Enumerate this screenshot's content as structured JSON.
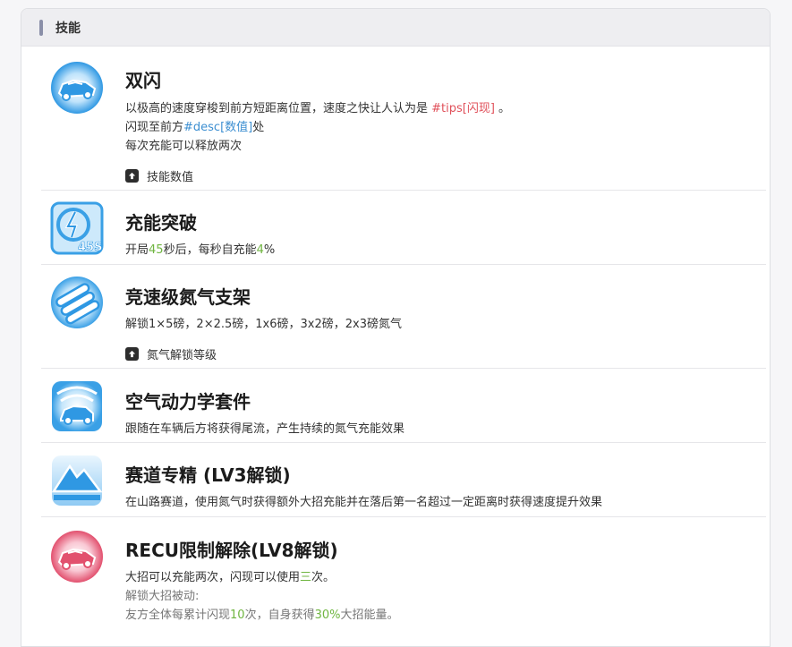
{
  "header": {
    "title": "技能"
  },
  "skills": [
    {
      "name": "双闪",
      "icon": "car-dash-icon",
      "l1a": "以极高的速度穿梭到前方短距离位置，速度之快让人认为是 ",
      "l1b": "#tips[闪现]",
      "l1c": " 。",
      "l2a": "闪现至前方",
      "l2b": "#desc[数值]",
      "l2c": "处",
      "l3": "每次充能可以释放两次",
      "toggle": "技能数值"
    },
    {
      "name": "充能突破",
      "icon": "timer-45s-icon",
      "l1a": "开局",
      "l1b": "45",
      "l1c": "秒后，每秒自充能",
      "l1d": "4",
      "l1e": "%"
    },
    {
      "name": "竞速级氮气支架",
      "icon": "nitro-tanks-icon",
      "l1": "解锁1×5磅，2×2.5磅，1x6磅，3x2磅，2x3磅氮气",
      "toggle": "氮气解锁等级"
    },
    {
      "name": "空气动力学套件",
      "icon": "aero-car-icon",
      "l1": "跟随在车辆后方将获得尾流，产生持续的氮气充能效果"
    },
    {
      "name": "赛道专精 (LV3解锁)",
      "icon": "mountain-icon",
      "l1": "在山路赛道，使用氮气时获得额外大招充能并在落后第一名超过一定距离时获得速度提升效果"
    },
    {
      "name": "RECU限制解除(LV8解锁)",
      "icon": "car-dash-red-icon",
      "l1a": "大招可以充能两次，闪现可以使用",
      "l1b": "三",
      "l1c": "次。",
      "l2": "解锁大招被动:",
      "l3a": "友方全体每累计闪现",
      "l3b": "10",
      "l3c": "次，自身获得",
      "l3d": "30%",
      "l3e": "大招能量。"
    }
  ],
  "colors": {
    "accent_red": "#e0505a",
    "accent_blue": "#3d8fd1",
    "accent_green": "#6fb540",
    "icon_blue": "#3aa0e6",
    "icon_red": "#e2506e"
  }
}
